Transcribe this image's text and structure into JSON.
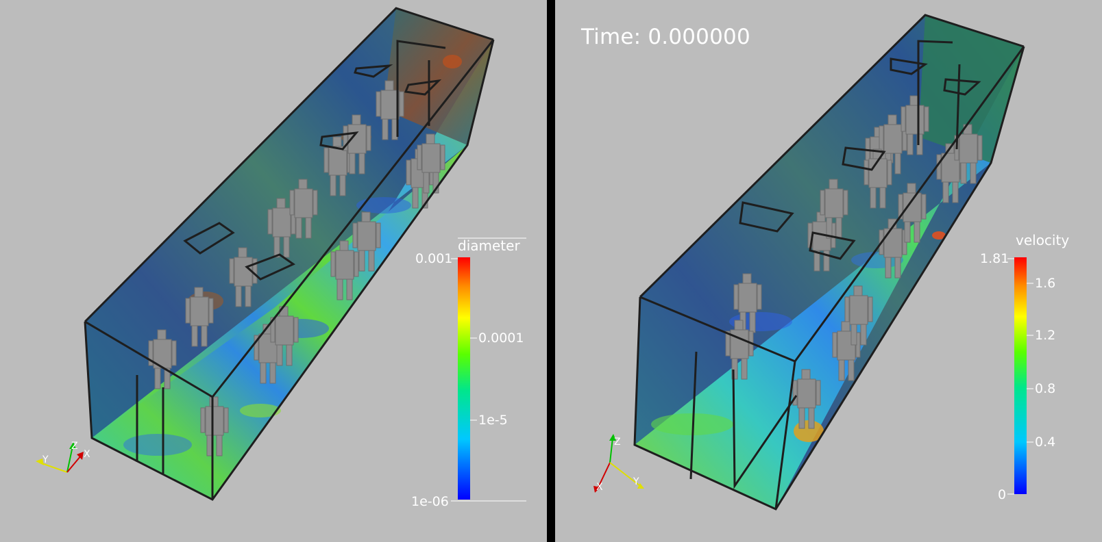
{
  "colors": {
    "background": "#bcbcbc",
    "divider": "#000000",
    "frame": "#1e1e1e",
    "label": "#ffffff",
    "person": "#8e8e8e"
  },
  "left_view": {
    "field": "diameter",
    "colorbar": {
      "title": "diameter",
      "scale": "log",
      "max_label": "0.001",
      "min_label": "1e-06",
      "tick_labels": [
        "0.0001",
        "1e-5"
      ]
    },
    "axes_triad": {
      "labels": [
        "Y",
        "Z",
        "X"
      ]
    }
  },
  "right_view": {
    "time_label": "Time: 0.000000",
    "field": "velocity",
    "colorbar": {
      "title": "velocity",
      "scale": "linear",
      "max_label": "1.81",
      "min_label": "0",
      "tick_labels": [
        "1.6",
        "1.2",
        "0.8",
        "0.4"
      ]
    },
    "axes_triad": {
      "labels": [
        "Z",
        "X",
        "Y"
      ]
    }
  }
}
